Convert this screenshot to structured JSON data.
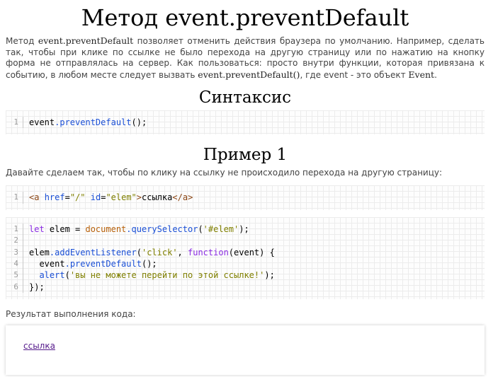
{
  "title": "Метод event.preventDefault",
  "intro": {
    "part1": "Метод ",
    "term1": "event.preventDefault",
    "part2": " позволяет отменить действия браузера по умолчанию. Например, сделать так, чтобы при клике по ссылке не было перехода на другую страницу или по нажатию на кнопку форма не отправлялась на сервер. Как пользоваться: просто внутри функции, которая привязана к событию, в любом месте следует вызвать ",
    "term2": "event.preventDefault()",
    "part3": ", где event - это объект ",
    "term3": "Event",
    "part4": "."
  },
  "syntax": {
    "heading": "Синтаксис",
    "lines": [
      {
        "n": "1",
        "code": "event.preventDefault();"
      }
    ]
  },
  "example1": {
    "heading": "Пример 1",
    "lead": "Давайте сделаем так, чтобы по клику на ссылку не происходило перехода на другую страницу:",
    "html_code": [
      {
        "n": "1",
        "code": "<a href=\"/\" id=\"elem\">ссылка</a>"
      }
    ],
    "js_code": [
      {
        "n": "1",
        "code": "let elem = document.querySelector('#elem');"
      },
      {
        "n": "2",
        "code": ""
      },
      {
        "n": "3",
        "code": "elem.addEventListener('click', function(event) {"
      },
      {
        "n": "4",
        "code": "  event.preventDefault();"
      },
      {
        "n": "5",
        "code": "  alert('вы не можете перейти по этой ссылке!');"
      },
      {
        "n": "6",
        "code": "});"
      }
    ],
    "result_label": "Результат выполнения кода:",
    "result_link": "ссылка"
  }
}
